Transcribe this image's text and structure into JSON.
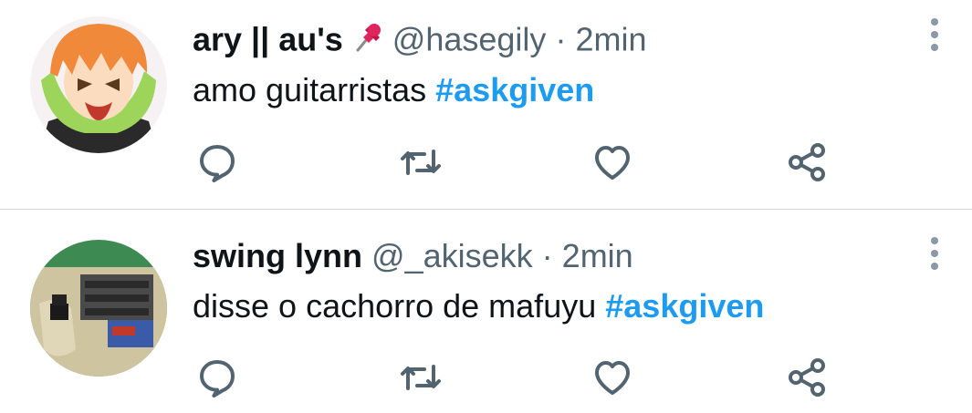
{
  "tweets": [
    {
      "display_name": "ary || au's",
      "pin_icon": "pushpin-icon",
      "handle": "@hasegily",
      "separator": "·",
      "time": "2min",
      "text": "amo guitarristas",
      "hashtag": "#askgiven",
      "avatar_colors": {
        "bg": "#f6f2f4",
        "hair": "#f08a3a",
        "skin": "#fcdcbf",
        "scarf": "#9dd45a",
        "shirt": "#2a2a2a"
      }
    },
    {
      "display_name": "swing lynn",
      "handle": "@_akisekk",
      "separator": "·",
      "time": "2min",
      "text": "disse o cachorro de mafuyu",
      "hashtag": "#askgiven",
      "avatar_colors": {
        "bg": "#3d8a52",
        "floor": "#cfc4a0",
        "cloth": "#3b5aa8",
        "red": "#c0392b"
      }
    }
  ],
  "actions": [
    "reply-icon",
    "retweet-icon",
    "like-icon",
    "share-icon"
  ],
  "colors": {
    "hashtag": "#1d9bf0",
    "secondary": "#536471",
    "icon": "#536471",
    "divider": "#cfd9de"
  }
}
